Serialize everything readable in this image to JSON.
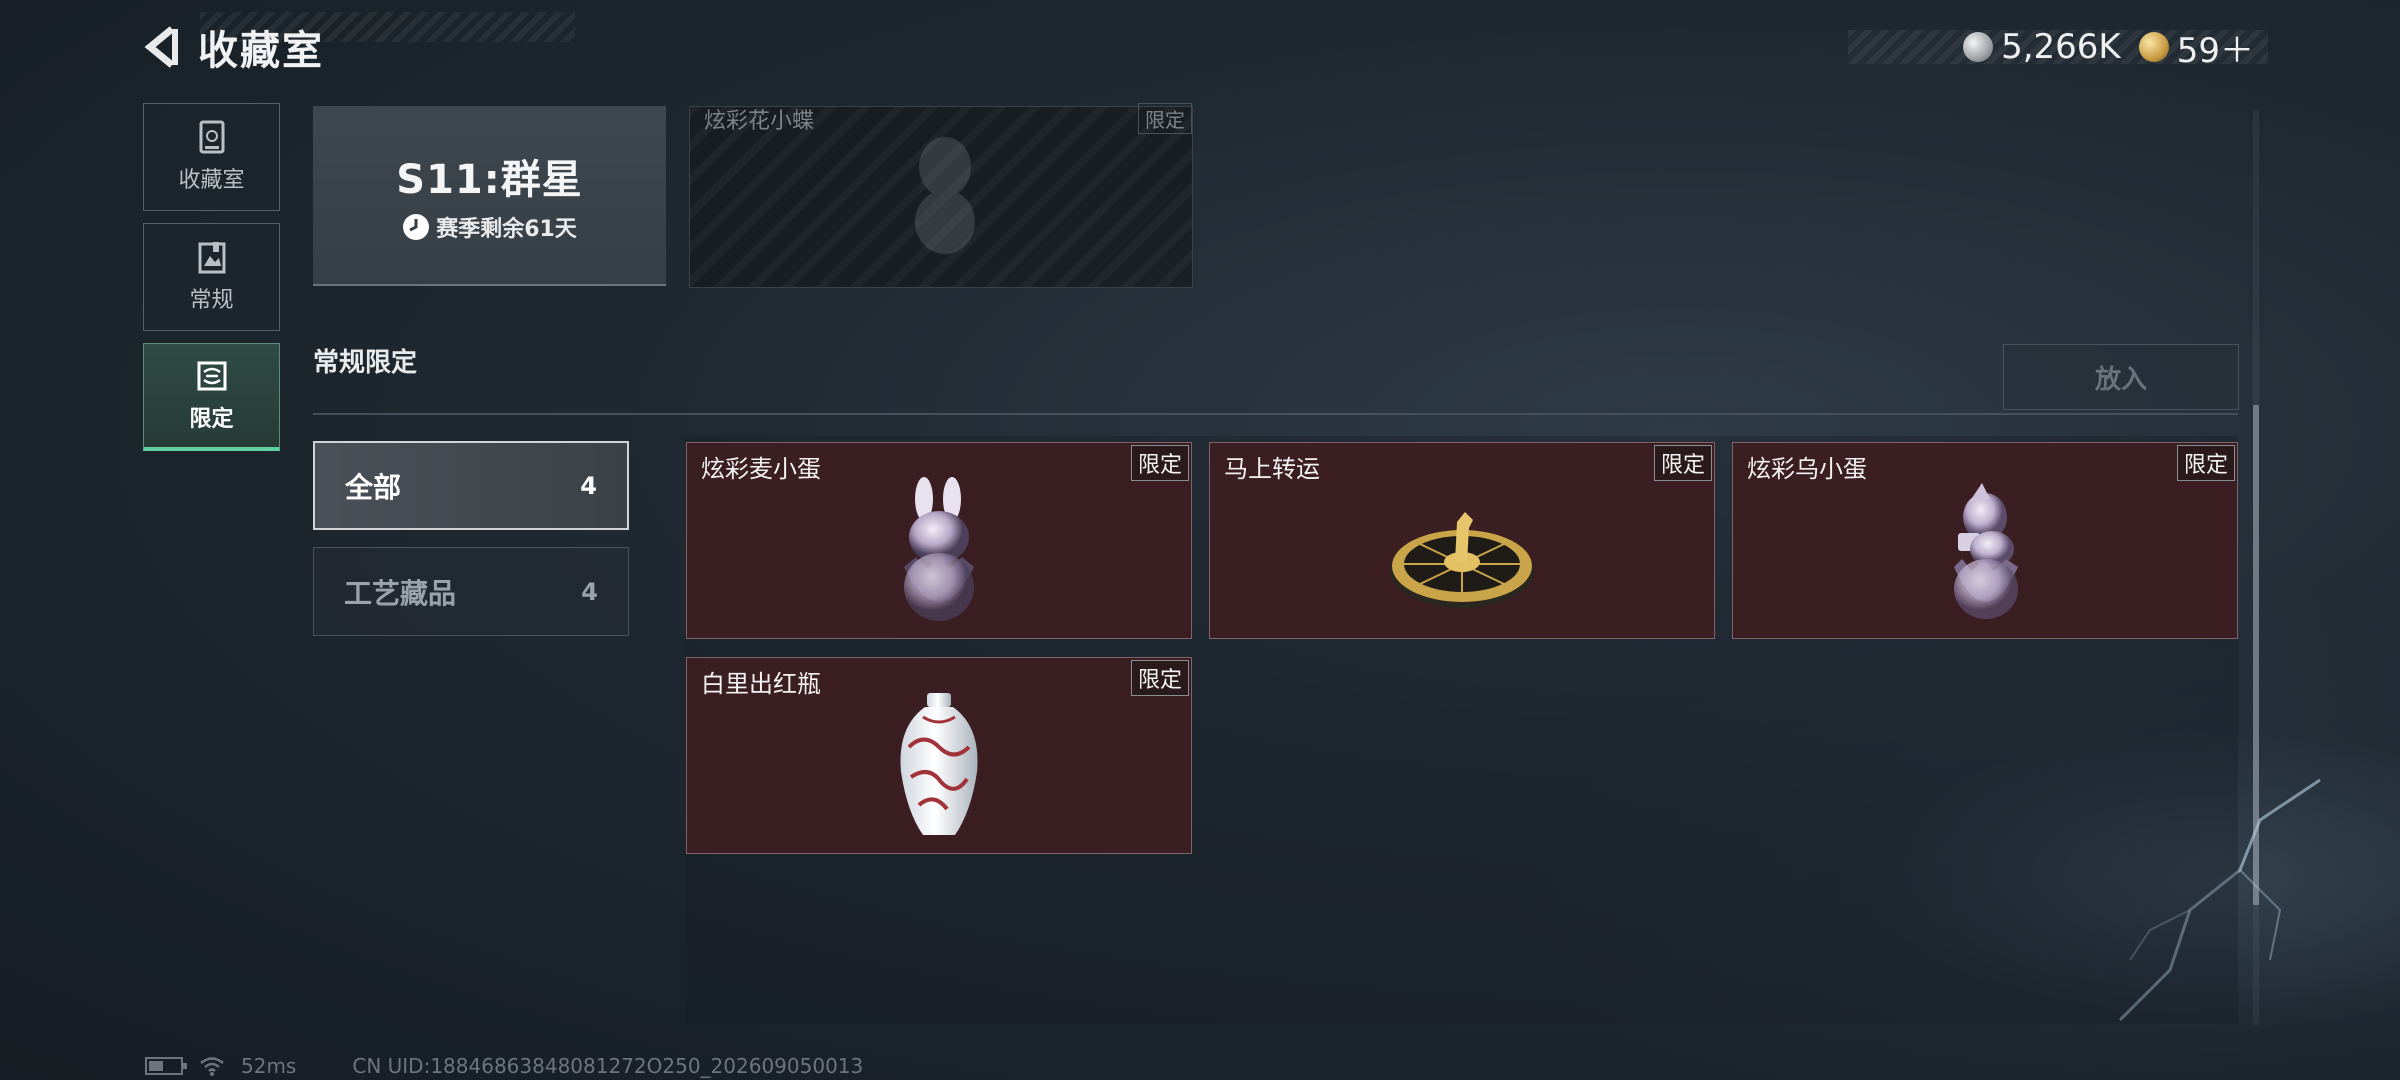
{
  "header": {
    "title": "收藏室"
  },
  "currency": [
    {
      "icon": "silver-coin-icon",
      "value": "5,266K"
    },
    {
      "icon": "gold-coin-icon",
      "value": "59＋"
    }
  ],
  "sidebar": {
    "items": [
      {
        "label": "收藏室",
        "icon": "collection-room-icon",
        "active": false
      },
      {
        "label": "常规",
        "icon": "regular-book-icon",
        "active": false
      },
      {
        "label": "限定",
        "icon": "limited-icon",
        "active": true
      }
    ]
  },
  "season": {
    "title": "S11:群星",
    "remain": "赛季剩余61天"
  },
  "ghost_item": {
    "name": "炫彩花小蝶",
    "tag": "限定"
  },
  "section": {
    "title": "常规限定",
    "put_label": "放入"
  },
  "filters": [
    {
      "name": "全部",
      "count": "4",
      "active": true
    },
    {
      "name": "工艺藏品",
      "count": "4",
      "active": false
    }
  ],
  "items": [
    {
      "name": "炫彩麦小蛋",
      "tag": "限定",
      "art": "rabbit-egg-icon"
    },
    {
      "name": "马上转运",
      "tag": "限定",
      "art": "golden-horse-compass-icon"
    },
    {
      "name": "炫彩乌小蛋",
      "tag": "限定",
      "art": "figure-egg-icon"
    },
    {
      "name": "白里出红瓶",
      "tag": "限定",
      "art": "porcelain-vase-icon"
    }
  ],
  "status": {
    "ping": "52ms",
    "battery_level": 0.45,
    "uid": "CN UID:18846863848081272O250_202609050013"
  },
  "colors": {
    "accent": "#5fd0a0",
    "card_bg": "#3a1e22",
    "background": "#1f2830"
  }
}
